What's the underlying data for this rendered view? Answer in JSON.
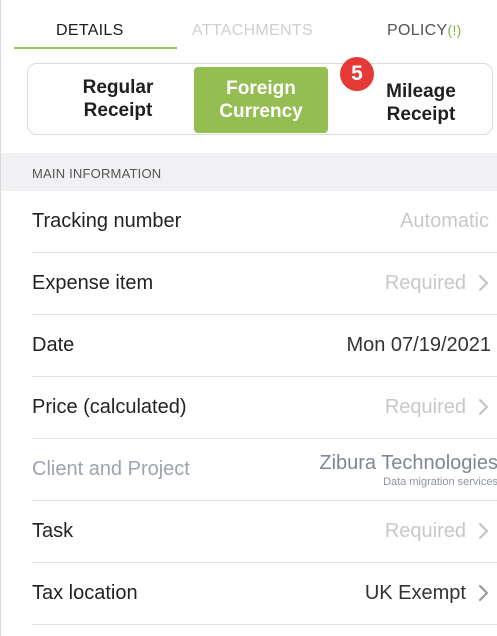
{
  "tabs": {
    "details": "DETAILS",
    "attachments": "ATTACHMENTS",
    "policy": "POLICY",
    "policy_flag": "(!)"
  },
  "segment": {
    "regular_line1": "Regular",
    "regular_line2": "Receipt",
    "foreign_line1": "Foreign",
    "foreign_line2": "Currency",
    "mileage_line1": "Mileage",
    "mileage_line2": "Receipt",
    "selected": "Foreign Currency"
  },
  "badge": "5",
  "section": {
    "title": "MAIN INFORMATION"
  },
  "rows": {
    "tracking": {
      "label": "Tracking number",
      "value": "Automatic"
    },
    "expense": {
      "label": "Expense item",
      "value": "Required"
    },
    "date": {
      "label": "Date",
      "value": "Mon 07/19/2021"
    },
    "price": {
      "label": "Price (calculated)",
      "value": "Required"
    },
    "client": {
      "label": "Client and Project",
      "value": "Zibura Technologies",
      "sub": "Data migration services"
    },
    "task": {
      "label": "Task",
      "value": "Required"
    },
    "tax": {
      "label": "Tax location",
      "value": "UK Exempt"
    }
  },
  "colors": {
    "accent": "#94be52",
    "badge": "#e53935",
    "placeholder": "#c8c8c8"
  },
  "icons": {
    "chevron": "chevron-right-icon"
  }
}
